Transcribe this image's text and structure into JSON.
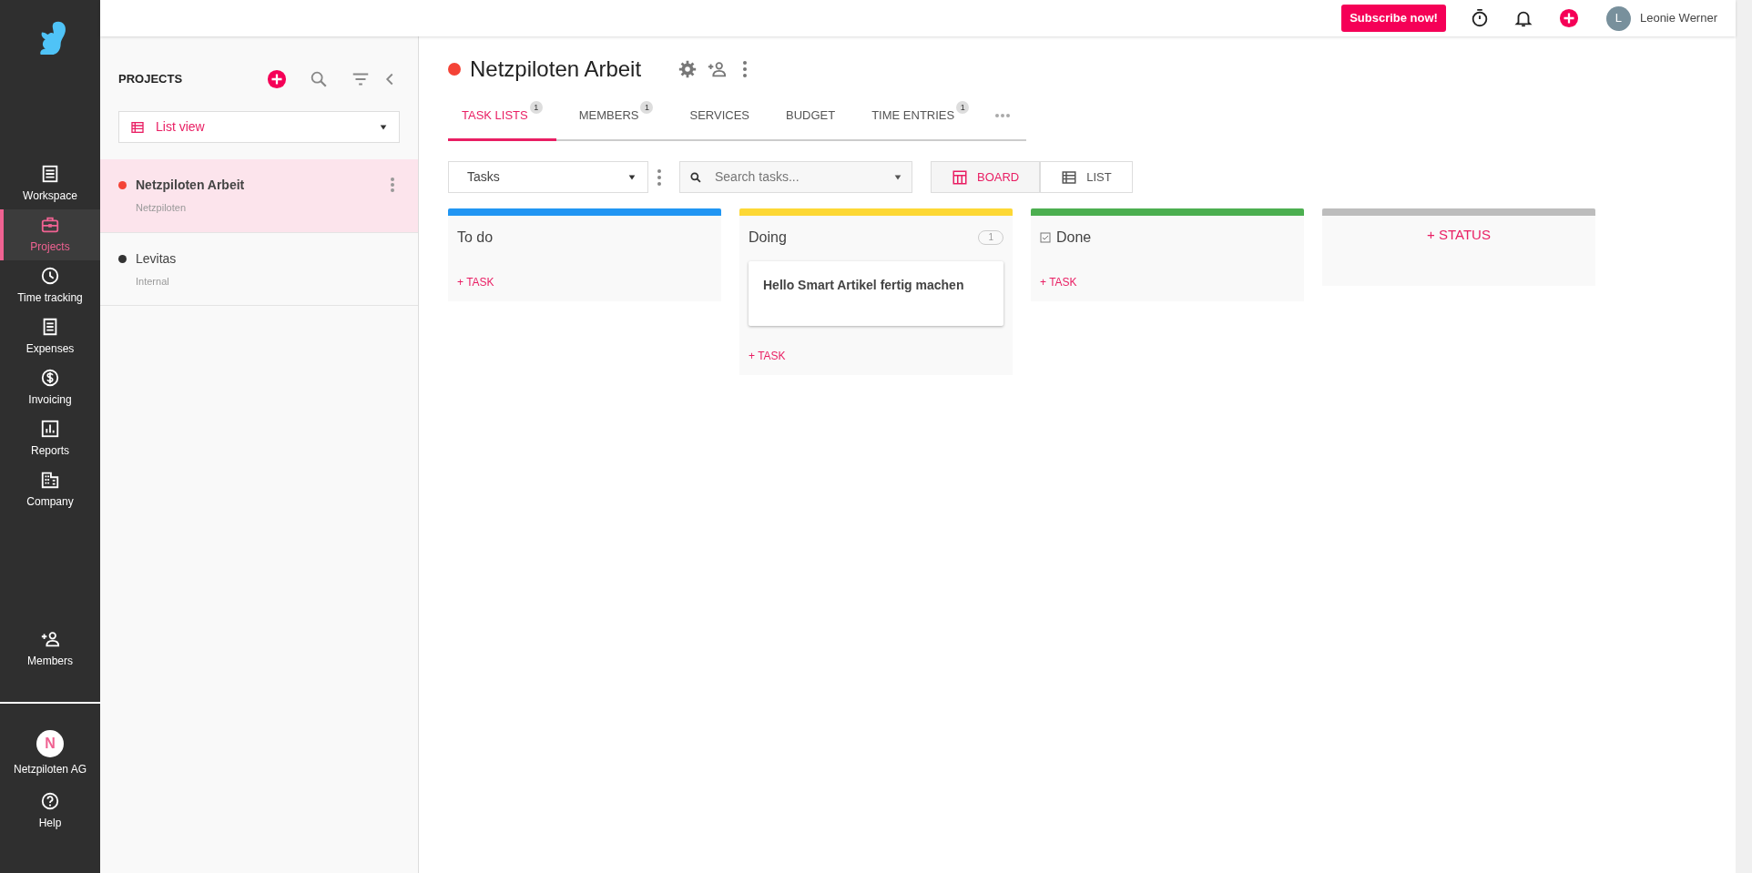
{
  "sidebar": {
    "items": [
      {
        "label": "Workspace",
        "selected": false
      },
      {
        "label": "Projects",
        "selected": true
      },
      {
        "label": "Time tracking",
        "selected": false
      },
      {
        "label": "Expenses",
        "selected": false
      },
      {
        "label": "Invoicing",
        "selected": false
      },
      {
        "label": "Reports",
        "selected": false
      },
      {
        "label": "Company",
        "selected": false
      }
    ],
    "members": {
      "label": "Members"
    },
    "organization": {
      "initial": "N",
      "name": "Netzpiloten AG"
    },
    "help": {
      "label": "Help"
    }
  },
  "top_bar": {
    "subscribe_button": "Subscribe now!",
    "user": {
      "initial": "L",
      "name": "Leonie Werner"
    }
  },
  "projects_panel": {
    "title": "PROJECTS",
    "view_select": "List view",
    "projects": [
      {
        "name": "Netzpiloten Arbeit",
        "client": "Netzpiloten",
        "color": "#f44336",
        "selected": true
      },
      {
        "name": "Levitas",
        "client": "Internal",
        "color": "#333333",
        "selected": false
      }
    ]
  },
  "project": {
    "title": "Netzpiloten Arbeit",
    "color": "#f44336",
    "tabs": [
      {
        "label": "TASK LISTS",
        "badge": "1",
        "selected": true
      },
      {
        "label": "MEMBERS",
        "badge": "1",
        "selected": false
      },
      {
        "label": "SERVICES",
        "selected": false
      },
      {
        "label": "BUDGET",
        "selected": false
      },
      {
        "label": "TIME ENTRIES",
        "badge": "1",
        "selected": false
      }
    ],
    "task_list_select": "Tasks",
    "search": {
      "placeholder": "Search tasks..."
    },
    "view_toggle": [
      {
        "label": "BOARD",
        "selected": true
      },
      {
        "label": "LIST",
        "selected": false
      }
    ],
    "columns": [
      {
        "title": "To do",
        "kind": "open",
        "color": "#2196f3",
        "add_label": "+ TASK"
      },
      {
        "title": "Doing",
        "kind": "open",
        "color": "#fdd835",
        "count": "1",
        "tasks": [
          "Hello Smart Artikel fertig machen"
        ],
        "add_label": "+ TASK"
      },
      {
        "title": "Done",
        "kind": "done",
        "color": "#4caf50",
        "add_label": "+ TASK"
      }
    ],
    "add_status": {
      "label": "+ STATUS",
      "color": "#bdbdbd"
    }
  }
}
